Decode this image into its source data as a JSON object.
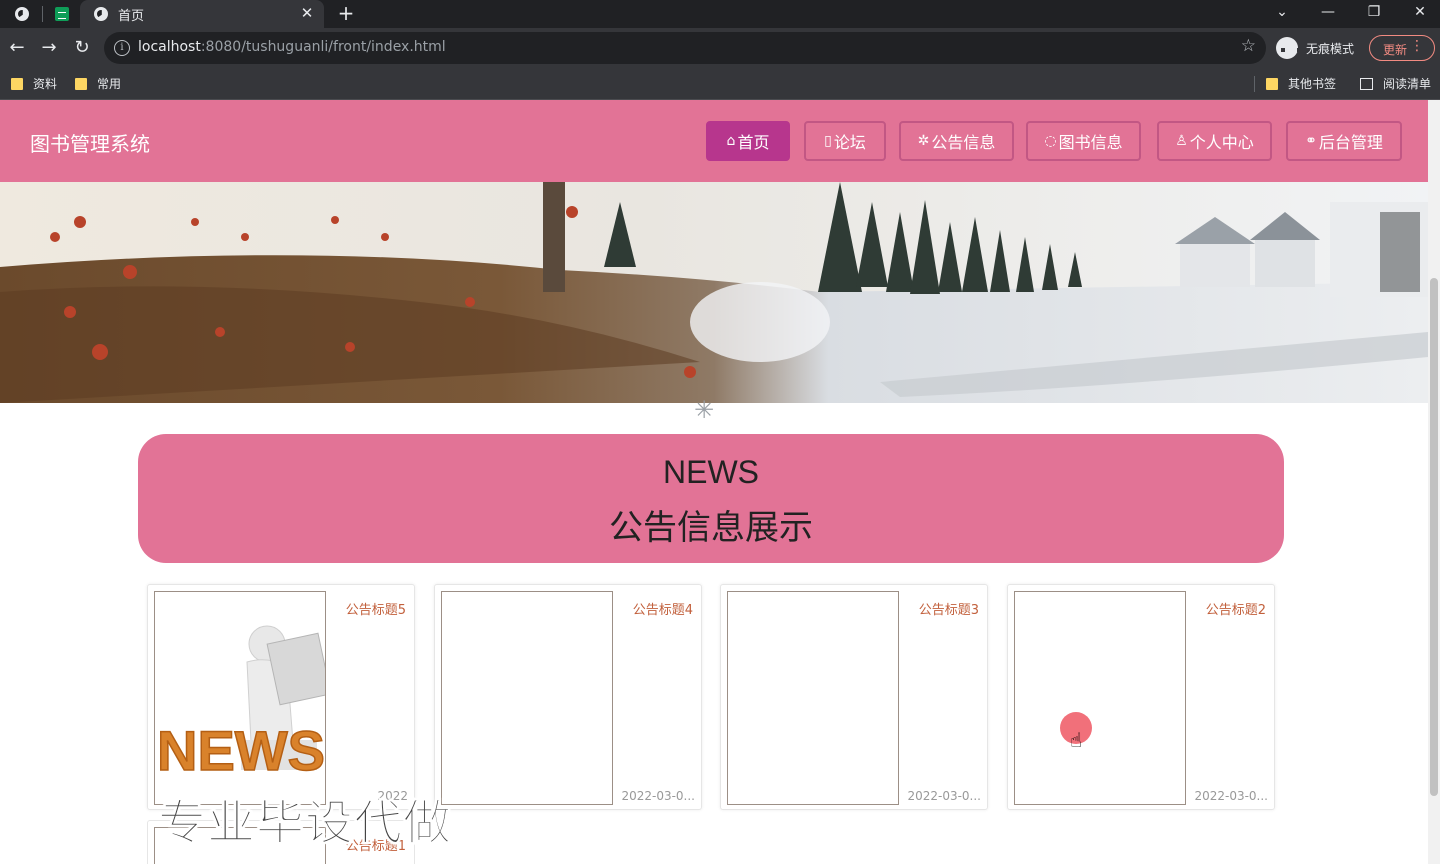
{
  "browser": {
    "tab_title": "首页",
    "tab_close": "✕",
    "new_tab": "+",
    "window_controls": {
      "list": "⌄",
      "minimize": "—",
      "restore": "❐",
      "close": "✕"
    },
    "nav": {
      "back": "←",
      "forward": "→",
      "reload": "↻"
    },
    "url_host": "localhost",
    "url_rest": ":8080/tushuguanli/front/index.html",
    "info_icon": "i",
    "star_icon": "☆",
    "incognito_label": "无痕模式",
    "update_label": "更新",
    "update_menu": "⋮",
    "bookmarks": [
      {
        "label": "资料"
      },
      {
        "label": "常用"
      }
    ],
    "bookmarks_right": [
      {
        "label": "其他书签"
      },
      {
        "label": "阅读清单"
      }
    ]
  },
  "site": {
    "title": "图书管理系统",
    "nav": [
      {
        "label": "首页",
        "icon": "home-icon",
        "glyph": "⌂",
        "active": true
      },
      {
        "label": "论坛",
        "icon": "forum-icon",
        "glyph": "▯",
        "active": false
      },
      {
        "label": "公告信息",
        "icon": "notice-icon",
        "glyph": "✲",
        "active": false
      },
      {
        "label": "图书信息",
        "icon": "book-icon",
        "glyph": "◌",
        "active": false
      },
      {
        "label": "个人中心",
        "icon": "user-icon",
        "glyph": "♙",
        "active": false
      },
      {
        "label": "后台管理",
        "icon": "link-icon",
        "glyph": "⚭",
        "active": false
      }
    ],
    "carousel_dots": 3,
    "carousel_active": 0
  },
  "news": {
    "heading_en": "NEWS",
    "heading_cn": "公告信息展示",
    "items": [
      {
        "title": "公告标题5",
        "date": "2022",
        "image_text": "NEWS"
      },
      {
        "title": "公告标题4",
        "date": "2022-03-0..."
      },
      {
        "title": "公告标题3",
        "date": "2022-03-0..."
      },
      {
        "title": "公告标题2",
        "date": "2022-03-0..."
      }
    ],
    "next_row_title": "公告标题1"
  },
  "watermark": "专业毕设代做",
  "colors": {
    "brand": "#e27396",
    "active_nav": "#b7368d",
    "title_text": "#c2603c"
  }
}
